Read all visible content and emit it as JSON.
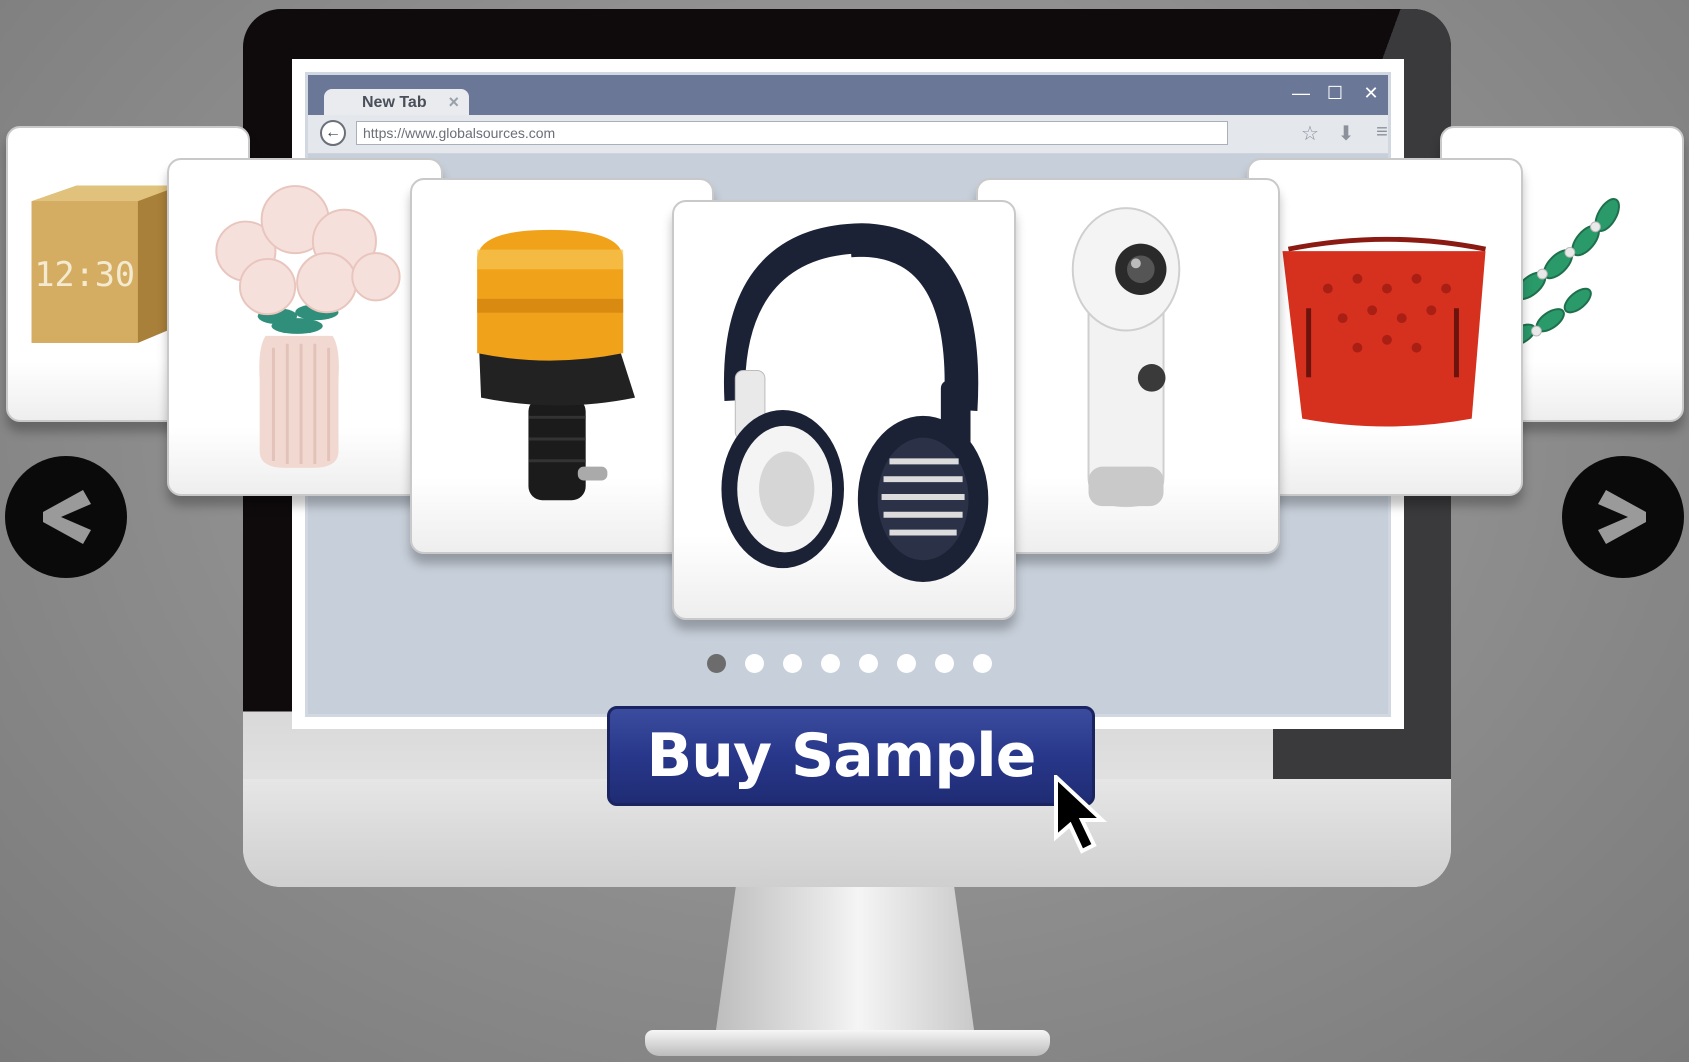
{
  "browser": {
    "tab_label": "New Tab",
    "tab_close": "×",
    "url": "https://www.globalsources.com",
    "window_controls": {
      "minimize": "—",
      "maximize": "☐",
      "close": "✕"
    },
    "back_icon": "←",
    "bookmark_icon": "☆",
    "download_icon": "⬇",
    "menu_icon": "≡"
  },
  "carousel": {
    "products": [
      "wooden-cube-clock",
      "flower-vase",
      "amber-beacon-light",
      "wireless-headphones",
      "360-camera",
      "red-handbag",
      "green-bracelet"
    ],
    "clock_display": "12:30",
    "selected_index": 3,
    "dot_count": 8,
    "active_dot": 0
  },
  "cta": {
    "label": "Buy Sample"
  },
  "nav": {
    "prev": "previous-arrow-icon",
    "next": "next-arrow-icon"
  },
  "colors": {
    "cta": "#28378a",
    "titlebar": "#6b7797",
    "background": "#8d8d8d"
  }
}
